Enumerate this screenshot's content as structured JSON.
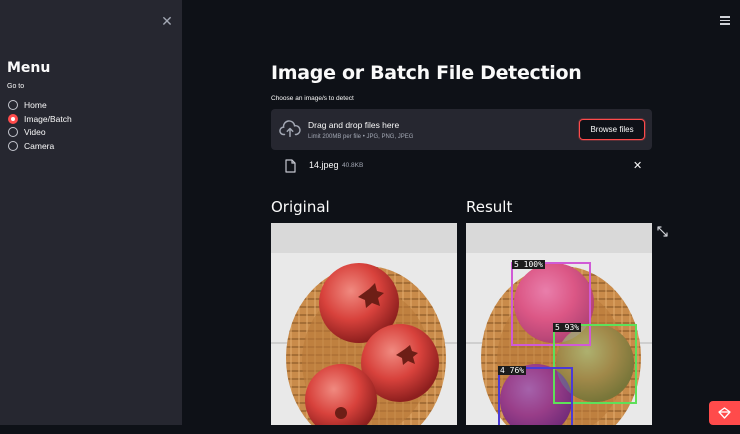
{
  "sidebar": {
    "title": "Menu",
    "radio_label": "Go to",
    "options": [
      "Home",
      "Image/Batch",
      "Video",
      "Camera"
    ],
    "selected_index": 1
  },
  "main": {
    "title": "Image or Batch File Detection",
    "uploader": {
      "label": "Choose an image/s to detect",
      "drop_text": "Drag and drop files here",
      "limit_text": "Limit 200MB per file • JPG, PNG, JPEG",
      "browse_label": "Browse files"
    },
    "file": {
      "name": "14.jpeg",
      "size": "40.8KB"
    },
    "columns": {
      "original": "Original",
      "result": "Result"
    },
    "detections": [
      {
        "label": "5 100%",
        "color": "#d05ad6"
      },
      {
        "label": "5 93%",
        "color": "#5ee05a"
      },
      {
        "label": "4 76%",
        "color": "#4b3ad6"
      }
    ]
  },
  "colors": {
    "accent": "#ff4b4b",
    "background": "#0e1117",
    "sidebar": "#262730"
  },
  "icons": [
    "close-icon",
    "menu-icon",
    "cloud-upload-icon",
    "file-icon",
    "expand-icon",
    "streamlit-icon"
  ]
}
